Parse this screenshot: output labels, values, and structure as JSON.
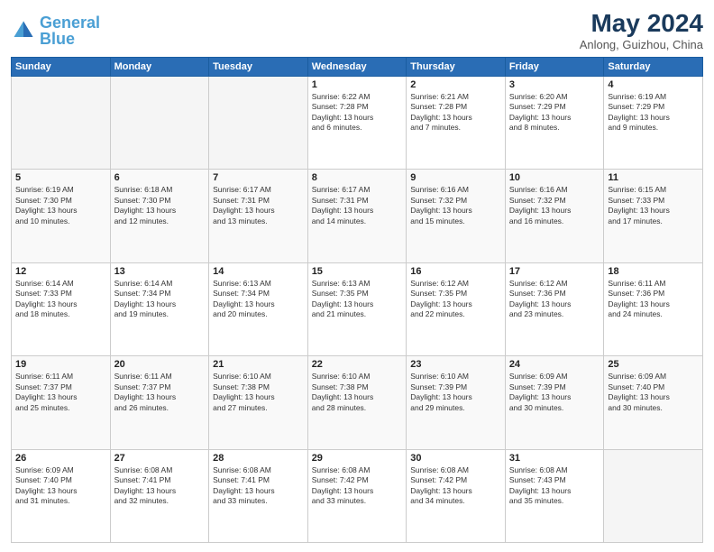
{
  "header": {
    "logo_general": "General",
    "logo_blue": "Blue",
    "month_title": "May 2024",
    "location": "Anlong, Guizhou, China"
  },
  "days_of_week": [
    "Sunday",
    "Monday",
    "Tuesday",
    "Wednesday",
    "Thursday",
    "Friday",
    "Saturday"
  ],
  "weeks": [
    [
      {
        "day": "",
        "info": ""
      },
      {
        "day": "",
        "info": ""
      },
      {
        "day": "",
        "info": ""
      },
      {
        "day": "1",
        "info": "Sunrise: 6:22 AM\nSunset: 7:28 PM\nDaylight: 13 hours\nand 6 minutes."
      },
      {
        "day": "2",
        "info": "Sunrise: 6:21 AM\nSunset: 7:28 PM\nDaylight: 13 hours\nand 7 minutes."
      },
      {
        "day": "3",
        "info": "Sunrise: 6:20 AM\nSunset: 7:29 PM\nDaylight: 13 hours\nand 8 minutes."
      },
      {
        "day": "4",
        "info": "Sunrise: 6:19 AM\nSunset: 7:29 PM\nDaylight: 13 hours\nand 9 minutes."
      }
    ],
    [
      {
        "day": "5",
        "info": "Sunrise: 6:19 AM\nSunset: 7:30 PM\nDaylight: 13 hours\nand 10 minutes."
      },
      {
        "day": "6",
        "info": "Sunrise: 6:18 AM\nSunset: 7:30 PM\nDaylight: 13 hours\nand 12 minutes."
      },
      {
        "day": "7",
        "info": "Sunrise: 6:17 AM\nSunset: 7:31 PM\nDaylight: 13 hours\nand 13 minutes."
      },
      {
        "day": "8",
        "info": "Sunrise: 6:17 AM\nSunset: 7:31 PM\nDaylight: 13 hours\nand 14 minutes."
      },
      {
        "day": "9",
        "info": "Sunrise: 6:16 AM\nSunset: 7:32 PM\nDaylight: 13 hours\nand 15 minutes."
      },
      {
        "day": "10",
        "info": "Sunrise: 6:16 AM\nSunset: 7:32 PM\nDaylight: 13 hours\nand 16 minutes."
      },
      {
        "day": "11",
        "info": "Sunrise: 6:15 AM\nSunset: 7:33 PM\nDaylight: 13 hours\nand 17 minutes."
      }
    ],
    [
      {
        "day": "12",
        "info": "Sunrise: 6:14 AM\nSunset: 7:33 PM\nDaylight: 13 hours\nand 18 minutes."
      },
      {
        "day": "13",
        "info": "Sunrise: 6:14 AM\nSunset: 7:34 PM\nDaylight: 13 hours\nand 19 minutes."
      },
      {
        "day": "14",
        "info": "Sunrise: 6:13 AM\nSunset: 7:34 PM\nDaylight: 13 hours\nand 20 minutes."
      },
      {
        "day": "15",
        "info": "Sunrise: 6:13 AM\nSunset: 7:35 PM\nDaylight: 13 hours\nand 21 minutes."
      },
      {
        "day": "16",
        "info": "Sunrise: 6:12 AM\nSunset: 7:35 PM\nDaylight: 13 hours\nand 22 minutes."
      },
      {
        "day": "17",
        "info": "Sunrise: 6:12 AM\nSunset: 7:36 PM\nDaylight: 13 hours\nand 23 minutes."
      },
      {
        "day": "18",
        "info": "Sunrise: 6:11 AM\nSunset: 7:36 PM\nDaylight: 13 hours\nand 24 minutes."
      }
    ],
    [
      {
        "day": "19",
        "info": "Sunrise: 6:11 AM\nSunset: 7:37 PM\nDaylight: 13 hours\nand 25 minutes."
      },
      {
        "day": "20",
        "info": "Sunrise: 6:11 AM\nSunset: 7:37 PM\nDaylight: 13 hours\nand 26 minutes."
      },
      {
        "day": "21",
        "info": "Sunrise: 6:10 AM\nSunset: 7:38 PM\nDaylight: 13 hours\nand 27 minutes."
      },
      {
        "day": "22",
        "info": "Sunrise: 6:10 AM\nSunset: 7:38 PM\nDaylight: 13 hours\nand 28 minutes."
      },
      {
        "day": "23",
        "info": "Sunrise: 6:10 AM\nSunset: 7:39 PM\nDaylight: 13 hours\nand 29 minutes."
      },
      {
        "day": "24",
        "info": "Sunrise: 6:09 AM\nSunset: 7:39 PM\nDaylight: 13 hours\nand 30 minutes."
      },
      {
        "day": "25",
        "info": "Sunrise: 6:09 AM\nSunset: 7:40 PM\nDaylight: 13 hours\nand 30 minutes."
      }
    ],
    [
      {
        "day": "26",
        "info": "Sunrise: 6:09 AM\nSunset: 7:40 PM\nDaylight: 13 hours\nand 31 minutes."
      },
      {
        "day": "27",
        "info": "Sunrise: 6:08 AM\nSunset: 7:41 PM\nDaylight: 13 hours\nand 32 minutes."
      },
      {
        "day": "28",
        "info": "Sunrise: 6:08 AM\nSunset: 7:41 PM\nDaylight: 13 hours\nand 33 minutes."
      },
      {
        "day": "29",
        "info": "Sunrise: 6:08 AM\nSunset: 7:42 PM\nDaylight: 13 hours\nand 33 minutes."
      },
      {
        "day": "30",
        "info": "Sunrise: 6:08 AM\nSunset: 7:42 PM\nDaylight: 13 hours\nand 34 minutes."
      },
      {
        "day": "31",
        "info": "Sunrise: 6:08 AM\nSunset: 7:43 PM\nDaylight: 13 hours\nand 35 minutes."
      },
      {
        "day": "",
        "info": ""
      }
    ]
  ]
}
